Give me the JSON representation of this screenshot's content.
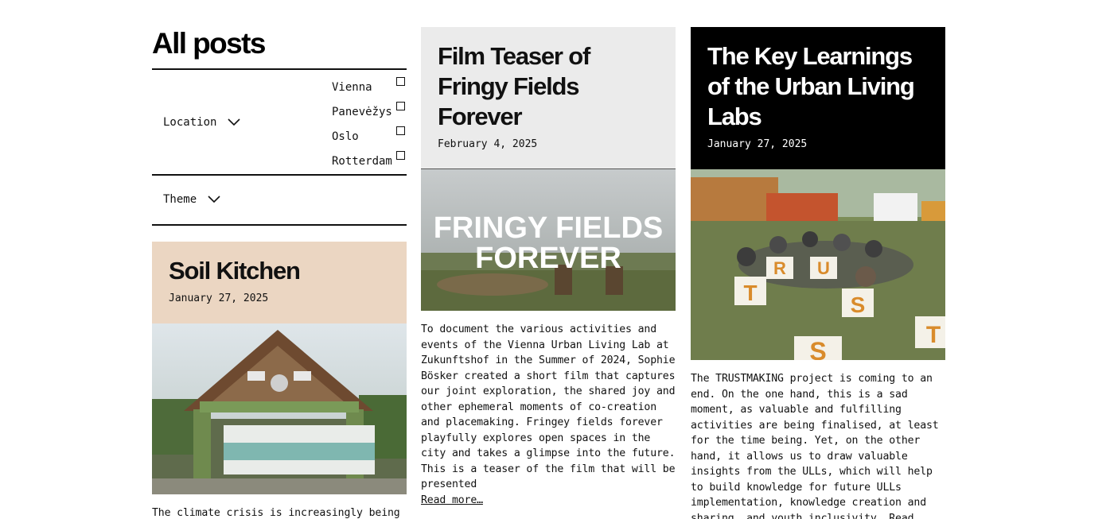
{
  "page": {
    "title": "All posts"
  },
  "filters": {
    "location": {
      "label": "Location",
      "options": [
        "Vienna",
        "Panevėžys",
        "Oslo",
        "Rotterdam"
      ]
    },
    "theme": {
      "label": "Theme"
    }
  },
  "posts": [
    {
      "title": "Soil Kitchen",
      "date": "January 27, 2025",
      "excerpt": "The climate crisis is increasingly being",
      "head_color": "#ebd6c2"
    },
    {
      "title_lines": [
        "Film Teaser of",
        "Fringy Fields",
        "Forever"
      ],
      "date": "February 4, 2025",
      "image_text_lines": [
        "FRINGY FIELDS",
        "FOREVER"
      ],
      "excerpt": "To document the various activities and events of the Vienna Urban Living Lab at Zukunftshof in the Summer of 2024, Sophie Bösker created a short film that captures our joint exploration, the shared joy and other ephemeral moments of co-creation and placemaking. Fringey fields forever playfully explores open spaces in the city and takes a glimpse into the future. This is a teaser of the film that will be presented",
      "read_more": "Read more…",
      "head_color": "#ebebeb"
    },
    {
      "title_lines": [
        "The Key Learnings",
        "of the Urban Living",
        "Labs"
      ],
      "date": "January 27, 2025",
      "excerpt": "The TRUSTMAKING project is coming to an end. On the one hand, this is a sad moment, as valuable and fulfilling activities are being finalised, at least for the time being. Yet, on the other hand, it allows us to draw valuable insights from the ULLs, which will help to build knowledge for future ULLs implementation, knowledge creation and sharing, and youth inclusivity. Read",
      "head_color": "#000000"
    }
  ],
  "icons": {
    "chevron": "chevron-down-icon",
    "checkbox": "checkbox-icon"
  }
}
